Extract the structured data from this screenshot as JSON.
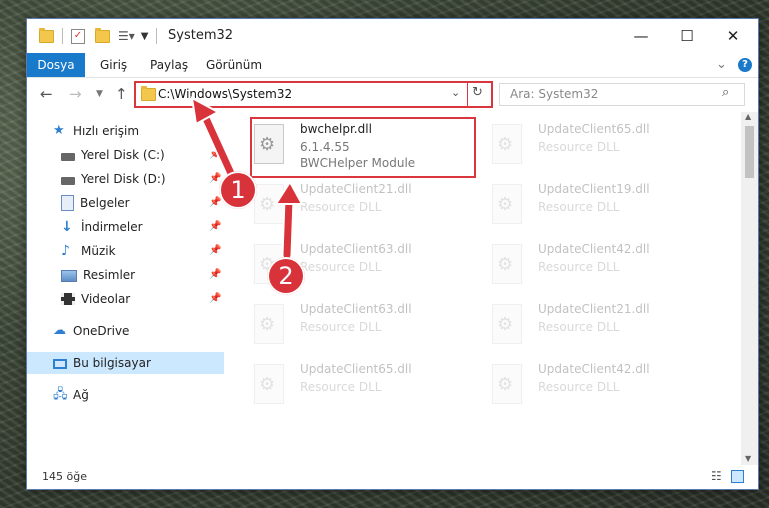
{
  "window": {
    "title": "System32",
    "controls": {
      "minimize": "—",
      "maximize": "☐",
      "close": "✕"
    }
  },
  "ribbon": {
    "tabs": [
      "Dosya",
      "Giriş",
      "Paylaş",
      "Görünüm"
    ],
    "collapse": "⌄",
    "help": "?"
  },
  "address": {
    "path": "C:\\Windows\\System32",
    "search_placeholder": "Ara: System32"
  },
  "nav": {
    "quick_access": "Hızlı erişim",
    "items": [
      {
        "label": "Yerel Disk (C:)",
        "icon": "drive-icon"
      },
      {
        "label": "Yerel Disk (D:)",
        "icon": "drive-icon"
      },
      {
        "label": "Belgeler",
        "icon": "documents-icon"
      },
      {
        "label": "İndirmeler",
        "icon": "download-icon"
      },
      {
        "label": "Müzik",
        "icon": "music-icon"
      },
      {
        "label": "Resimler",
        "icon": "pictures-icon"
      },
      {
        "label": "Videolar",
        "icon": "video-icon"
      }
    ],
    "onedrive": "OneDrive",
    "this_pc": "Bu bilgisayar",
    "network": "Ağ"
  },
  "files": {
    "highlight": {
      "name": "bwchelpr.dll",
      "version": "6.1.4.55",
      "description": "BWCHelper Module"
    },
    "tiles": [
      {
        "name": "UpdateClient65.dll",
        "type": "Resource DLL"
      },
      {
        "name": "UpdateClient21.dll",
        "type": "Resource DLL"
      },
      {
        "name": "UpdateClient19.dll",
        "type": "Resource DLL"
      },
      {
        "name": "UpdateClient63.dll",
        "type": "Resource DLL"
      },
      {
        "name": "UpdateClient42.dll",
        "type": "Resource DLL"
      },
      {
        "name": "UpdateClient63.dll",
        "type": "Resource DLL"
      },
      {
        "name": "UpdateClient21.dll",
        "type": "Resource DLL"
      },
      {
        "name": "UpdateClient65.dll",
        "type": "Resource DLL"
      },
      {
        "name": "UpdateClient42.dll",
        "type": "Resource DLL"
      }
    ]
  },
  "status": {
    "count": "145 öğe"
  },
  "annotations": {
    "step1": "1",
    "step2": "2"
  },
  "colors": {
    "accent": "#1979ca",
    "highlight": "#d9363e",
    "selection": "#cce8ff"
  }
}
